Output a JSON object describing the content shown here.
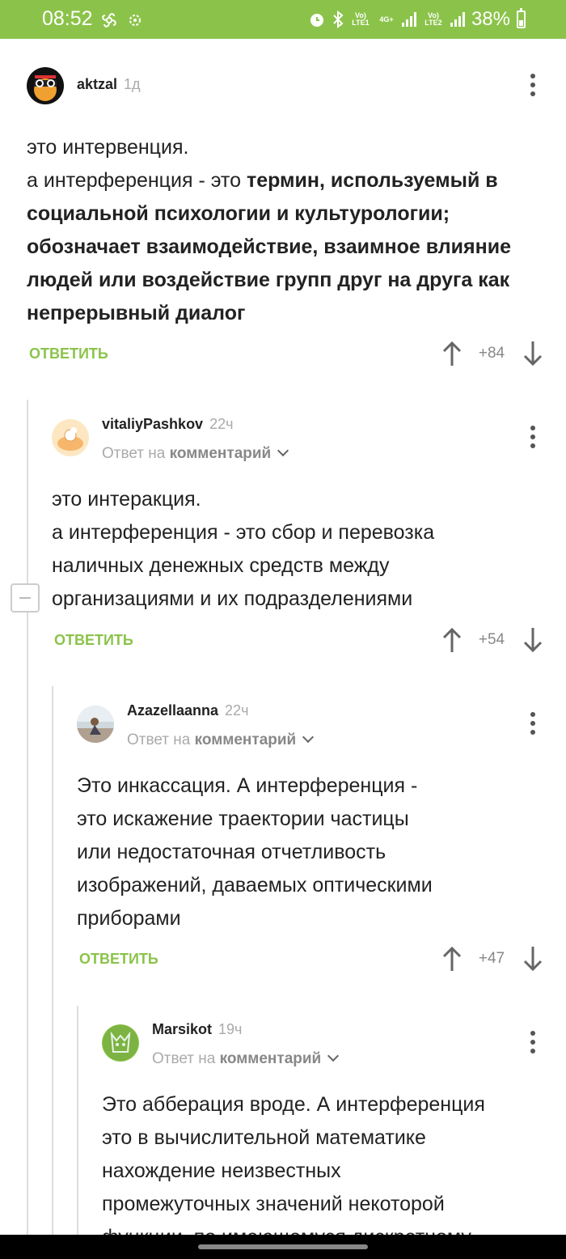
{
  "status": {
    "time": "08:52",
    "net1": "Vo) LTE1",
    "net2": "4G+",
    "net3": "Vo) LTE2",
    "battery": "38%"
  },
  "comments": [
    {
      "user": "aktzal",
      "time": "1д",
      "text_plain": "это интервенция.\nа интерференция - это ",
      "text_bold": "термин, используемый в социальной психологии и культурологии; обозначает взаимодействие, взаимное влияние людей или воздействие групп друг на друга как непрерывный диалог",
      "reply": "ОТВЕТИТЬ",
      "score": "+84"
    },
    {
      "user": "vitaliyPashkov",
      "time": "22ч",
      "reply_prefix": "Ответ на",
      "reply_target": "комментарий",
      "line1": "это интеракция.",
      "line2": "а интерференция - это сбор и перевозка",
      "line3": "наличных денежных средств между",
      "line4": "организациями и их подразделениями",
      "reply": "ОТВЕТИТЬ",
      "score": "+54"
    },
    {
      "user": "Azazellaanna",
      "time": "22ч",
      "reply_prefix": "Ответ на",
      "reply_target": "комментарий",
      "line1": "Это инкассация. А интерференция -",
      "line2": "это искажение траектории частицы",
      "line3": "или недостаточная отчетливость",
      "line4": "изображений, даваемых оптическими",
      "line5": "приборами",
      "reply": "ОТВЕТИТЬ",
      "score": "+47"
    },
    {
      "user": "Marsikot",
      "time": "19ч",
      "reply_prefix": "Ответ на",
      "reply_target": "комментарий",
      "line1": "Это абберация вроде. А интерференция",
      "line2": "это в вычислительной математике",
      "line3": "нахождение неизвестных",
      "line4": "промежуточных значений некоторой",
      "line5": "функции, по имеющемуся дискретному"
    }
  ]
}
